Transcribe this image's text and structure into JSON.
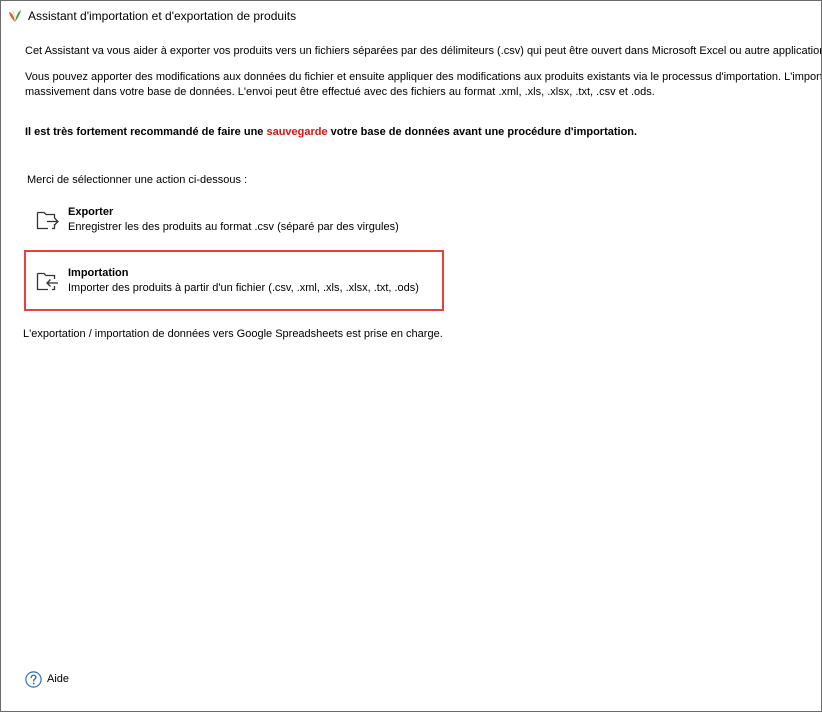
{
  "window": {
    "title": "Assistant d'importation et d'exportation de produits",
    "icon": "app-logo-icon"
  },
  "intro": {
    "line1": "Cet Assistant va vous aider à exporter vos produits vers un fichiers séparées par des délimiteurs (.csv) qui peut être ouvert dans Microsoft Excel ou autre application",
    "line2": "Vous pouvez apporter des modifications aux données du fichier et ensuite appliquer des modifications aux produits existants via le processus d'importation. L'importation",
    "line3": "massivement dans votre base de données. L'envoi peut être effectué avec des fichiers au format .xml, .xls, .xlsx, .txt, .csv et .ods."
  },
  "warning": {
    "before": "Il est très fortement recommandé de faire une ",
    "highlight": "sauvegarde",
    "after": " votre base de données avant une procédure d'importation."
  },
  "prompt": "Merci de sélectionner une action ci-dessous :",
  "actions": [
    {
      "title": "Exporter",
      "description": "Enregistrer les des produits au format .csv (séparé par des virgules)",
      "icon": "folder-export-icon"
    },
    {
      "title": "Importation",
      "description": "Importer des produits à partir d'un fichier (.csv, .xml, .xls, .xlsx, .txt, .ods)",
      "icon": "folder-import-icon"
    }
  ],
  "note": "L'exportation / importation de données vers Google Spreadsheets est prise en charge.",
  "help": {
    "label": "Aide",
    "icon": "help-icon"
  },
  "colors": {
    "highlight_text": "#e01010",
    "selection_border": "#e8413b",
    "help_icon": "#2f6fb7"
  }
}
